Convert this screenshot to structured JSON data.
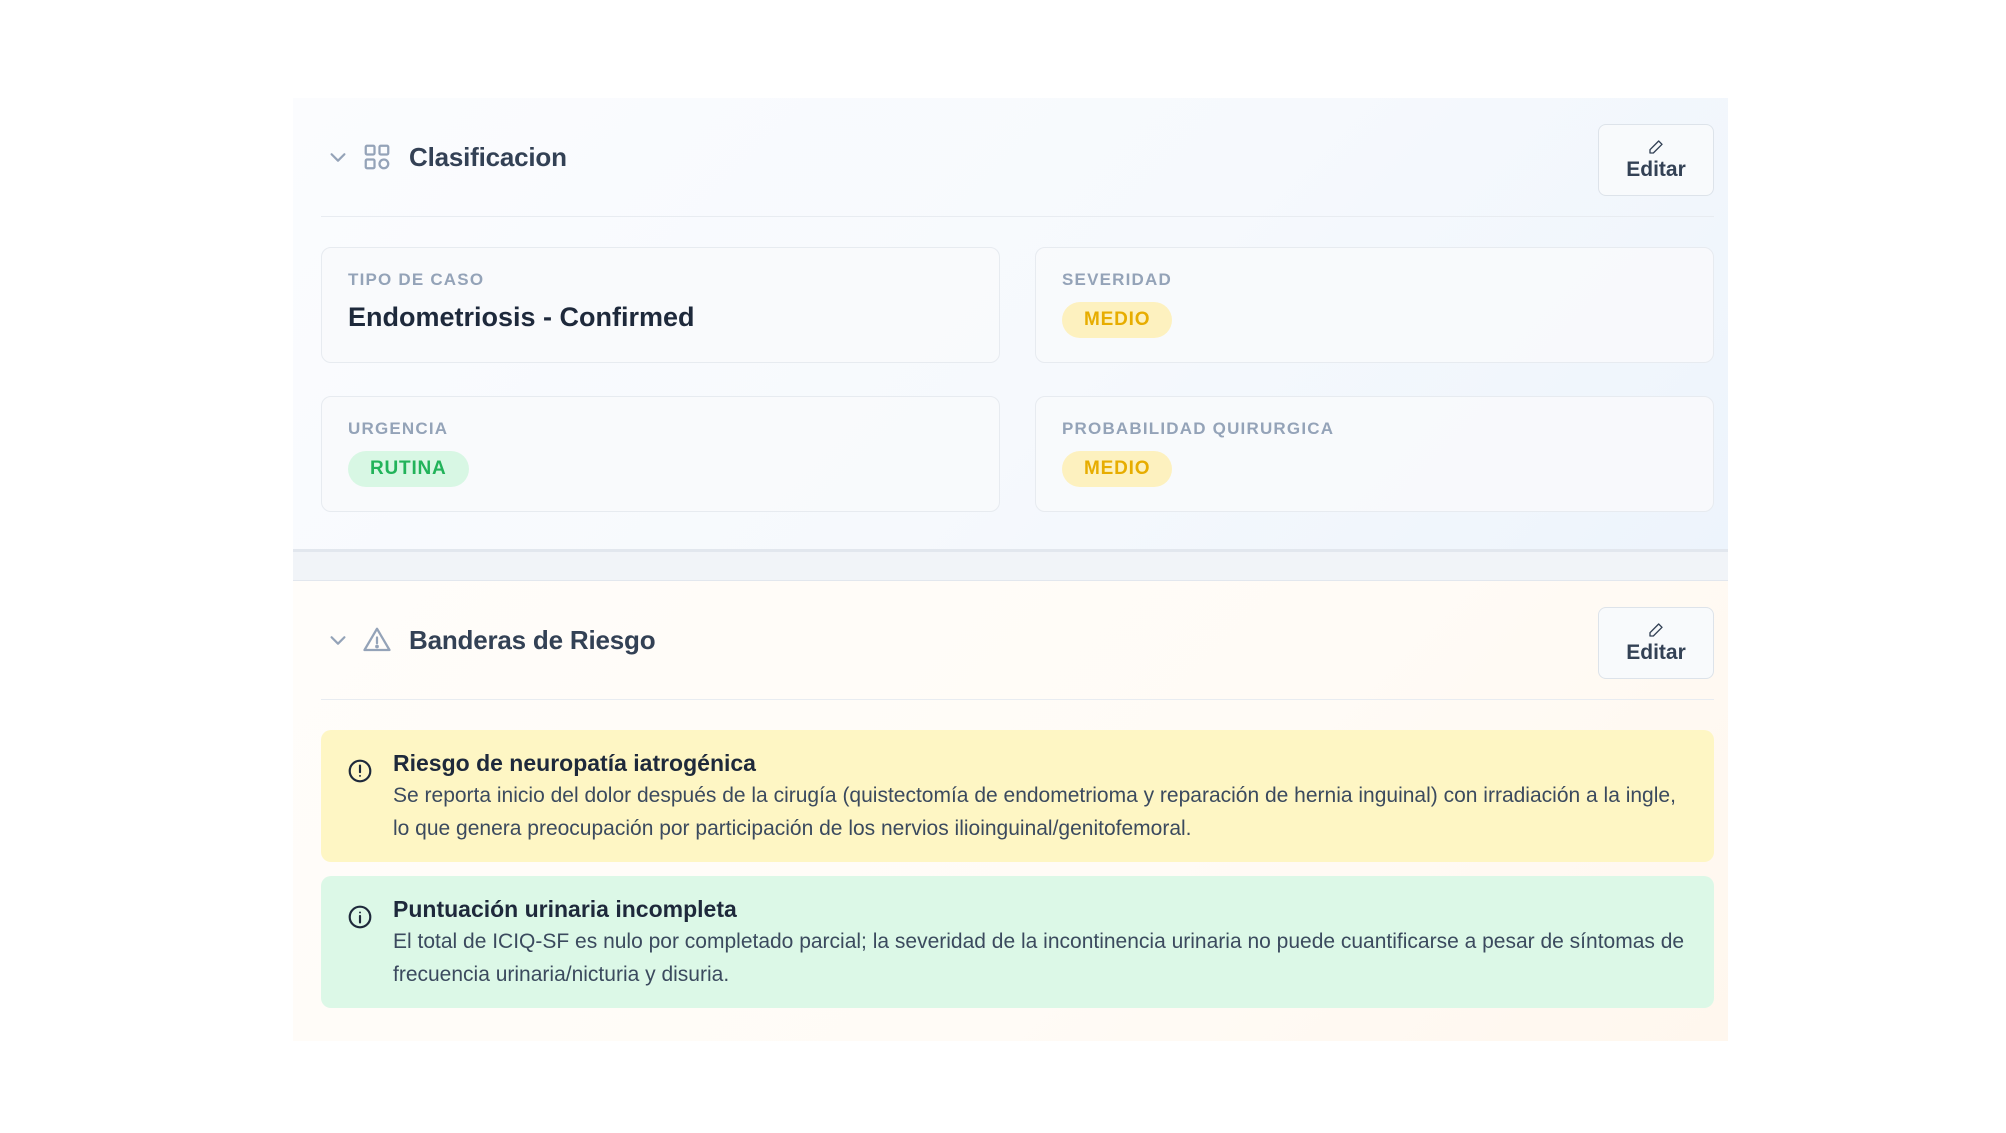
{
  "classification": {
    "title": "Clasificacion",
    "edit_label": "Editar",
    "cards": [
      {
        "label": "TIPO DE CASO",
        "value": "Endometriosis - Confirmed"
      },
      {
        "label": "SEVERIDAD",
        "badge": "MEDIO",
        "badge_color": "#e7ad00"
      },
      {
        "label": "URGENCIA",
        "badge": "RUTINA",
        "badge_color": "#22b35a"
      },
      {
        "label": "PROBABILIDAD QUIRURGICA",
        "badge": "MEDIO",
        "badge_color": "#e7ad00"
      }
    ]
  },
  "risk_flags": {
    "title": "Banderas de Riesgo",
    "edit_label": "Editar",
    "alerts": [
      {
        "title": "Riesgo de neuropatía iatrogénica",
        "text": "Se reporta inicio del dolor después de la cirugía (quistectomía de endometrioma y reparación de hernia inguinal) con irradiación a la ingle, lo que genera preocupación por participación de los nervios ilioinguinal/genitofemoral.",
        "icon": "alert-circle-icon",
        "color": "#fef6c4"
      },
      {
        "title": "Puntuación urinaria incompleta",
        "text": "El total de ICIQ-SF es nulo por completado parcial; la severidad de la incontinencia urinaria no puede cuantificarse a pesar de síntomas de frecuencia urinaria/nicturia y disuria.",
        "icon": "info-circle-icon",
        "color": "#dcf8e7"
      }
    ]
  }
}
